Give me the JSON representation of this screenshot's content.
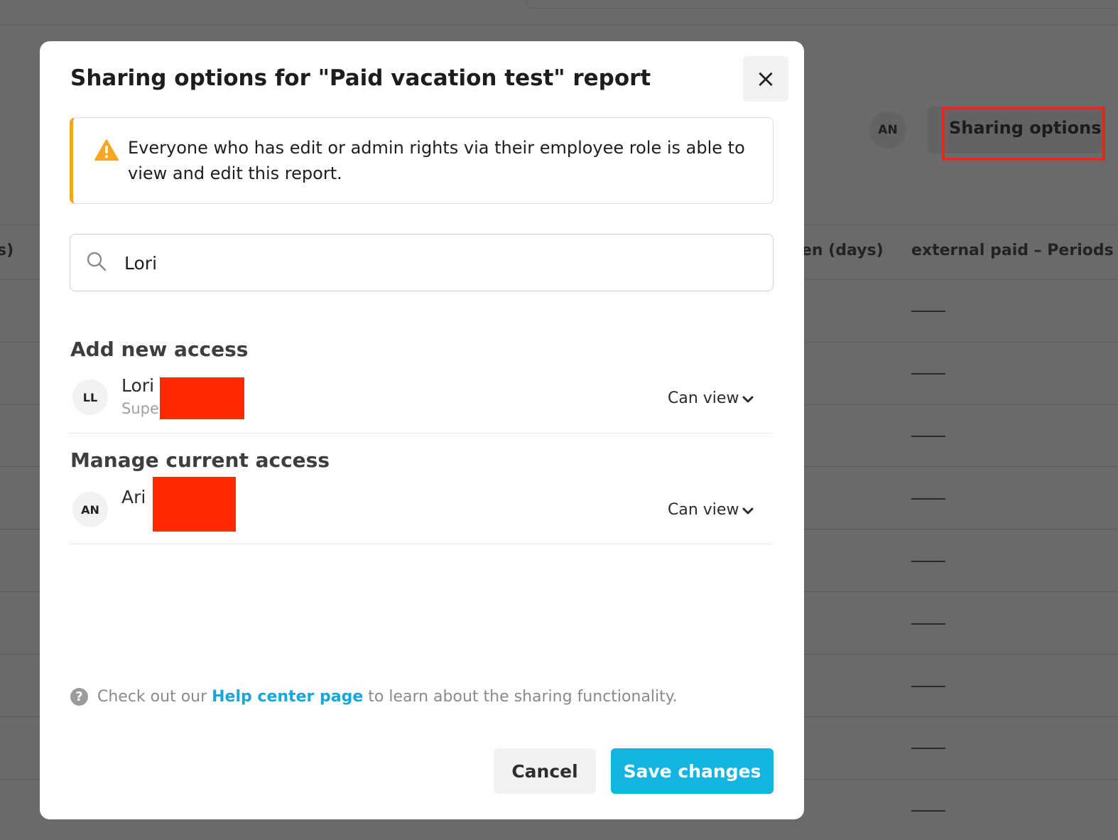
{
  "background": {
    "avatar_initials": "AN",
    "sharing_button_label": "Sharing options",
    "columns": [
      "s)",
      "en (days)",
      "external paid – Periods"
    ],
    "empty_cell": "——"
  },
  "modal": {
    "title": "Sharing options for \"Paid vacation test\" report",
    "close_label": "×",
    "alert": {
      "icon": "warning-icon",
      "text": "Everyone who has edit or admin rights via their employee role is able to view and edit this report."
    },
    "search": {
      "icon": "search-icon",
      "value": "Lori"
    },
    "add_new_access": {
      "title": "Add new access",
      "users": [
        {
          "initials": "LL",
          "name": "Lori",
          "role": "Super",
          "permission": "Can view"
        }
      ]
    },
    "manage_current_access": {
      "title": "Manage current access",
      "users": [
        {
          "initials": "AN",
          "name": "Ari",
          "permission": "Can view"
        }
      ]
    },
    "help": {
      "prefix": "Check out our ",
      "link": "Help center page",
      "suffix": " to learn about the sharing functionality."
    },
    "cancel_label": "Cancel",
    "save_label": "Save changes"
  },
  "colors": {
    "primary": "#14b4e0",
    "warning": "#f5a623",
    "link": "#1ba6d8",
    "highlight": "#e5281c"
  }
}
